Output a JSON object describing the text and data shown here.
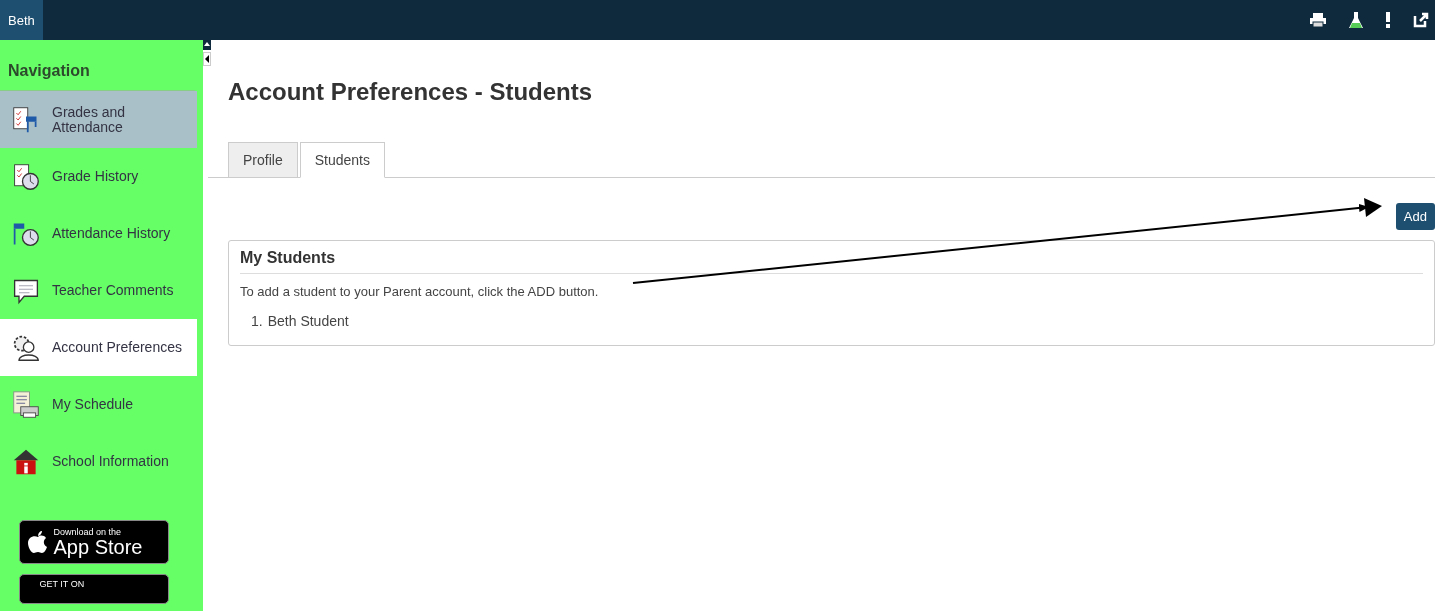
{
  "top_bar": {
    "user": "Beth"
  },
  "sidebar": {
    "heading": "Navigation",
    "items": [
      {
        "kind": "grades",
        "label": "Grades and Attendance",
        "selected": false,
        "highlighted": true
      },
      {
        "kind": "grade-history",
        "label": "Grade History",
        "selected": false,
        "highlighted": false
      },
      {
        "kind": "attendance-history",
        "label": "Attendance History",
        "selected": false,
        "highlighted": false
      },
      {
        "kind": "comments",
        "label": "Teacher Comments",
        "selected": false,
        "highlighted": false
      },
      {
        "kind": "preferences",
        "label": "Account Preferences",
        "selected": true,
        "highlighted": false
      },
      {
        "kind": "schedule",
        "label": "My Schedule",
        "selected": false,
        "highlighted": false
      },
      {
        "kind": "school",
        "label": "School Information",
        "selected": false,
        "highlighted": false
      }
    ],
    "badges": [
      {
        "kind": "apple",
        "small": "Download on the",
        "big": "App Store"
      },
      {
        "kind": "google",
        "small": "GET IT ON"
      }
    ]
  },
  "page_title": "Account Preferences - Students",
  "tabs": [
    {
      "label": "Profile",
      "selected": false
    },
    {
      "label": "Students",
      "selected": true
    }
  ],
  "add_button": "Add",
  "panel": {
    "title": "My Students",
    "instruction": "To add a student to your Parent account, click the ADD button.",
    "students": [
      {
        "number": "1.",
        "name": "Beth Student"
      }
    ]
  }
}
